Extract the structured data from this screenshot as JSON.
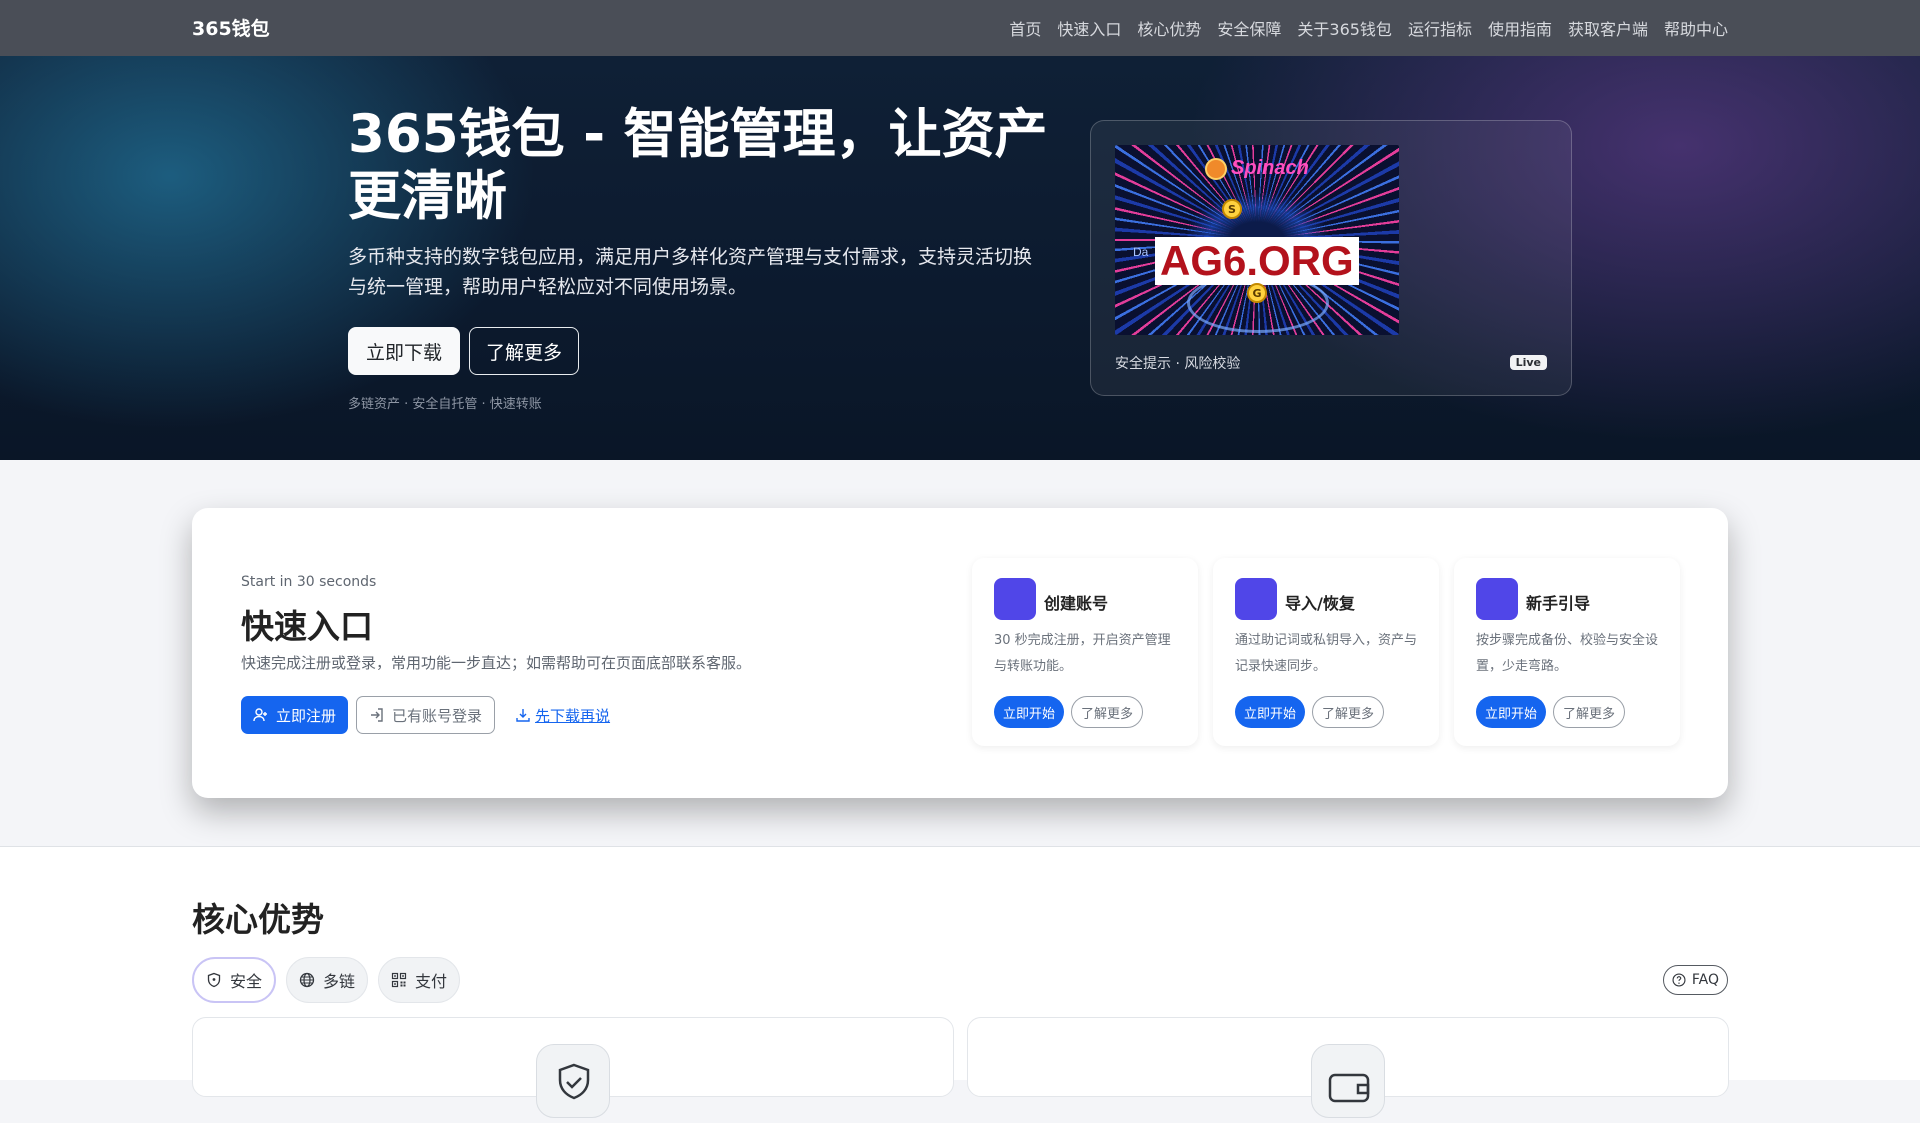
{
  "navbar": {
    "brand": "365钱包",
    "links": [
      "首页",
      "快速入口",
      "核心优势",
      "安全保障",
      "关于365钱包",
      "运行指标",
      "使用指南",
      "获取客户端",
      "帮助中心"
    ]
  },
  "hero": {
    "title": "365钱包 - 智能管理，让资产更清晰",
    "subtitle": "多币种支持的数字钱包应用，满足用户多样化资产管理与支付需求，支持灵活切换与统一管理，帮助用户轻松应对不同使用场景。",
    "download_label": "立即下载",
    "learn_more_label": "了解更多",
    "tags": "多链资产 · 安全自托管 · 快速转账",
    "media": {
      "logo_text": "Spinach",
      "watermark": "AG6.ORG",
      "partial_text": "Da",
      "coin_top": "S",
      "coin_bottom": "G",
      "caption": "安全提示 · 风险校验",
      "badge": "Live"
    }
  },
  "quick_start": {
    "kicker": "Start in 30 seconds",
    "title": "快速入口",
    "description": "快速完成注册或登录，常用功能一步直达；如需帮助可在页面底部联系客服。",
    "register_label": "立即注册",
    "login_label": "已有账号登录",
    "download_first_label": "先下载再说",
    "steps": [
      {
        "title": "创建账号",
        "description": "30 秒完成注册，开启资产管理与转账功能。",
        "start_label": "立即开始",
        "more_label": "了解更多"
      },
      {
        "title": "导入/恢复",
        "description": "通过助记词或私钥导入，资产与记录快速同步。",
        "start_label": "立即开始",
        "more_label": "了解更多"
      },
      {
        "title": "新手引导",
        "description": "按步骤完成备份、校验与安全设置，少走弯路。",
        "start_label": "立即开始",
        "more_label": "了解更多"
      }
    ]
  },
  "advantages": {
    "title": "核心优势",
    "tabs": [
      {
        "label": "安全",
        "icon": "shield-icon"
      },
      {
        "label": "多链",
        "icon": "globe-icon"
      },
      {
        "label": "支付",
        "icon": "qr-code-icon"
      }
    ],
    "faq_label": "FAQ"
  },
  "colors": {
    "primary": "#1565ef",
    "accent_purple": "#5046e8",
    "navbar": "#4a4e57",
    "hero_dark": "#0c1a2e"
  }
}
